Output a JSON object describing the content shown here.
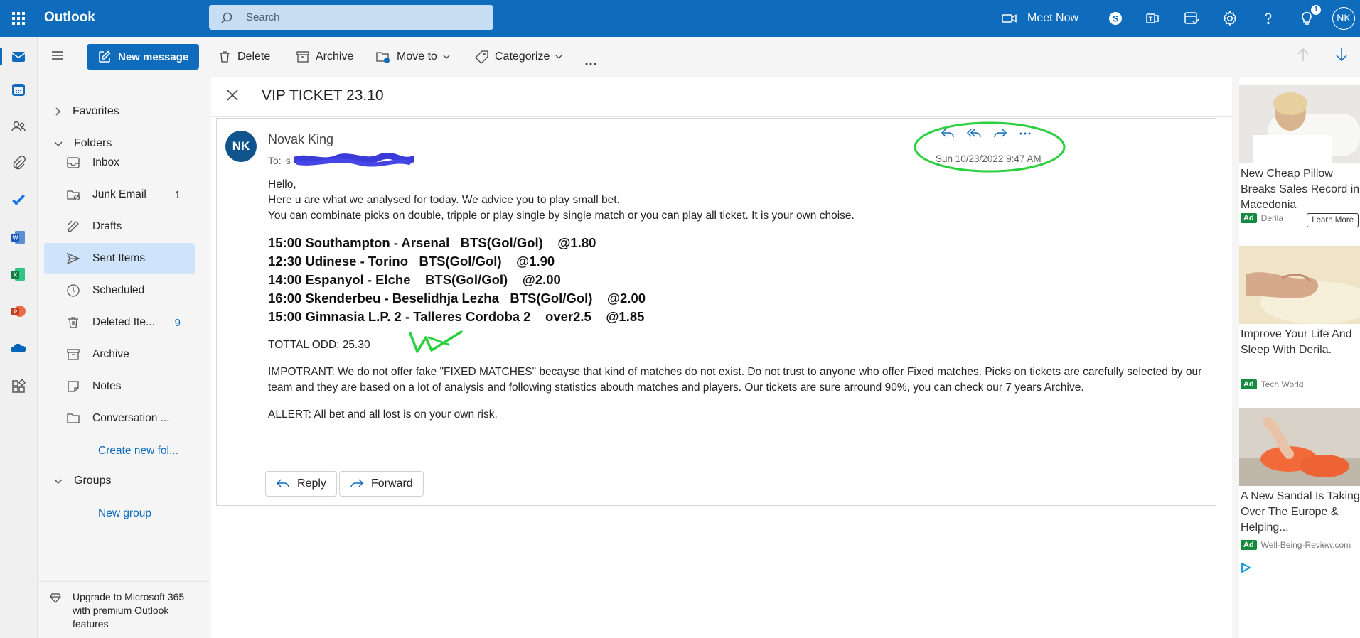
{
  "topbar": {
    "app_name": "Outlook",
    "search_placeholder": "Search",
    "meet_now": "Meet Now",
    "notification_count": "1",
    "avatar_initials": "NK"
  },
  "nav": {
    "new_message": "New message",
    "favorites": "Favorites",
    "folders": "Folders",
    "items": [
      {
        "label": "Inbox",
        "count": ""
      },
      {
        "label": "Junk Email",
        "count": "1"
      },
      {
        "label": "Drafts",
        "count": ""
      },
      {
        "label": "Sent Items",
        "count": ""
      },
      {
        "label": "Scheduled",
        "count": ""
      },
      {
        "label": "Deleted Ite...",
        "count": "9"
      },
      {
        "label": "Archive",
        "count": ""
      },
      {
        "label": "Notes",
        "count": ""
      },
      {
        "label": "Conversation ...",
        "count": ""
      }
    ],
    "create_folder": "Create new fol...",
    "groups": "Groups",
    "new_group": "New group",
    "upgrade": "Upgrade to Microsoft 365 with premium Outlook features"
  },
  "toolbar": {
    "delete": "Delete",
    "archive": "Archive",
    "move_to": "Move to",
    "categorize": "Categorize"
  },
  "message": {
    "subject": "VIP TICKET 23.10",
    "sender": "Novak King",
    "sender_initials": "NK",
    "to_label": "To:",
    "to_prefix": "s",
    "date": "Sun 10/23/2022 9:47 AM",
    "greeting": "Hello,",
    "line1": "Here u are what we analysed for today. We advice you to play small bet.",
    "line2": "You can combinate picks on double, tripple or play single by single match or you can play all ticket. It is your own choise.",
    "picks": [
      "15:00 Southampton - Arsenal   BTS(Gol/Gol)    @1.80",
      "12:30 Udinese - Torino   BTS(Gol/Gol)    @1.90",
      "14:00 Espanyol - Elche    BTS(Gol/Gol)    @2.00",
      "16:00 Skenderbeu - Beselidhja Lezha   BTS(Gol/Gol)    @2.00",
      "15:00 Gimnasia L.P. 2 - Talleres Cordoba 2    over2.5    @1.85"
    ],
    "total": "TOTTAL ODD: 25.30",
    "important": "IMPOTRANT: We do not offer fake \"FIXED MATCHES\" becayse that kind of matches do not exist. Do not trust to anyone who offer Fixed matches. Picks on tickets are carefully selected by our team and they are based on a lot of analysis and following statistics abouth matches and players. Our tickets are sure arround 90%, you can check our 7 years Archive.",
    "allert": "ALLERT: All bet and all lost is on your own risk.",
    "reply": "Reply",
    "forward": "Forward"
  },
  "ads": [
    {
      "title": "New Cheap Pillow Breaks Sales Record in Macedonia",
      "badge": "Ad",
      "source": "Derila",
      "cta": "Learn More"
    },
    {
      "title": "Improve Your Life And Sleep With Derila.",
      "badge": "Ad",
      "source": "Tech World"
    },
    {
      "title": "A New Sandal Is Taking Over The Europe & Helping...",
      "badge": "Ad",
      "source": "Well-Being-Review.com"
    }
  ],
  "colors": {
    "brand": "#0f6cbd",
    "selected": "#cfe4fa",
    "annotation": "#2bd040",
    "redaction": "#3b3bd9"
  }
}
